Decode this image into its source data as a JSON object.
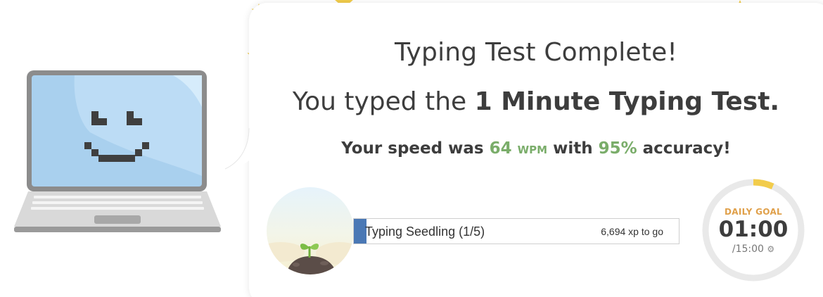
{
  "result": {
    "title": "Typing Test Complete!",
    "subtitle_prefix": "You typed the ",
    "subtitle_test_name": "1 Minute Typing Test.",
    "speed_prefix": "Your speed was ",
    "speed_value": "64",
    "speed_unit": "WPM",
    "speed_middle": " with ",
    "accuracy_value": "95%",
    "speed_suffix": " accuracy!"
  },
  "level": {
    "label": "Typing Seedling (1/5)",
    "xp_to_go": "6,694 xp to go",
    "progress_fraction": 0.04
  },
  "daily_goal": {
    "label": "DAILY GOAL",
    "time": "01:00",
    "total": "/15:00",
    "settings_icon": "gear-icon",
    "progress_fraction": 0.0667
  },
  "colors": {
    "accent_green": "#7aad6a",
    "progress_blue": "#4a78b5",
    "goal_orange": "#e0a04a",
    "star_yellow": "#f2cc4b",
    "laptop_screen": "#a9d0ee"
  }
}
